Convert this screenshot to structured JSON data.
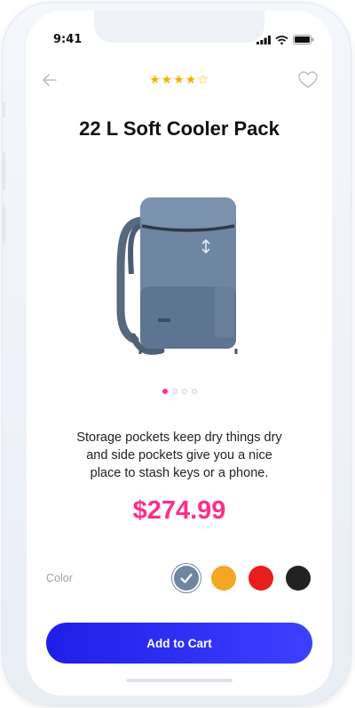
{
  "status_bar": {
    "time": "9:41"
  },
  "header": {
    "rating": "★★★★☆",
    "back_icon": "arrow-left-icon",
    "favorite_icon": "heart-icon"
  },
  "product": {
    "title": "22 L Soft Cooler Pack",
    "description_lines": [
      "Storage pockets keep dry things dry",
      "and side pockets give you a nice",
      "place to stash keys or a phone."
    ],
    "price": "$274.99",
    "image_count": 4,
    "active_image": 1
  },
  "options": {
    "color_label": "Color",
    "colors": [
      "#6f86a3",
      "#f5a623",
      "#e81d1d",
      "#222222"
    ],
    "selected_color": 0
  },
  "actions": {
    "add_to_cart": "Add to Cart"
  }
}
